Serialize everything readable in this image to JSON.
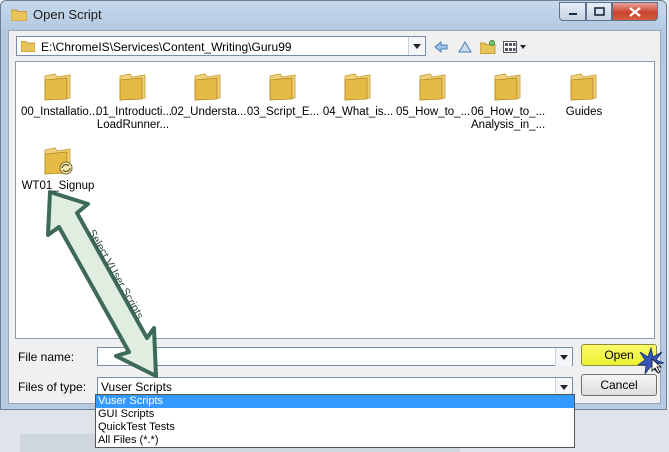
{
  "window": {
    "title": "Open Script"
  },
  "lookin": {
    "path": "E:\\ChromeIS\\Services\\Content_Writing\\Guru99"
  },
  "toolbar": {
    "back_icon": "back-arrow-icon",
    "up_icon": "up-folder-icon",
    "newfolder_icon": "new-folder-icon",
    "view_icon": "view-menu-icon"
  },
  "files": [
    {
      "line1": "00_Installatio...",
      "line2": ""
    },
    {
      "line1": "01_Introducti...",
      "line2": "LoadRunner..."
    },
    {
      "line1": "02_Understa...",
      "line2": ""
    },
    {
      "line1": "03_Script_E...",
      "line2": ""
    },
    {
      "line1": "04_What_is...",
      "line2": ""
    },
    {
      "line1": "05_How_to_...",
      "line2": ""
    },
    {
      "line1": "06_How_to_...",
      "line2": "Analysis_in_..."
    },
    {
      "line1": "Guides",
      "line2": ""
    },
    {
      "line1": "WT01_Signup",
      "line2": ""
    }
  ],
  "form": {
    "filename_label": "File name:",
    "filename_value": "",
    "filetype_label": "Files of type:",
    "filetype_value": "Vuser Scripts",
    "open_label": "Open",
    "cancel_label": "Cancel"
  },
  "filetype_options": [
    "Vuser Scripts",
    "GUI Scripts",
    "QuickTest Tests",
    "All Files (*.*)"
  ],
  "annotation": {
    "text": "Select VUser Scripts"
  },
  "colors": {
    "highlight": "#3399ff",
    "open_button": "#eef23a",
    "arrow_fill": "#dfeee0",
    "arrow_stroke": "#3e6a5a"
  }
}
